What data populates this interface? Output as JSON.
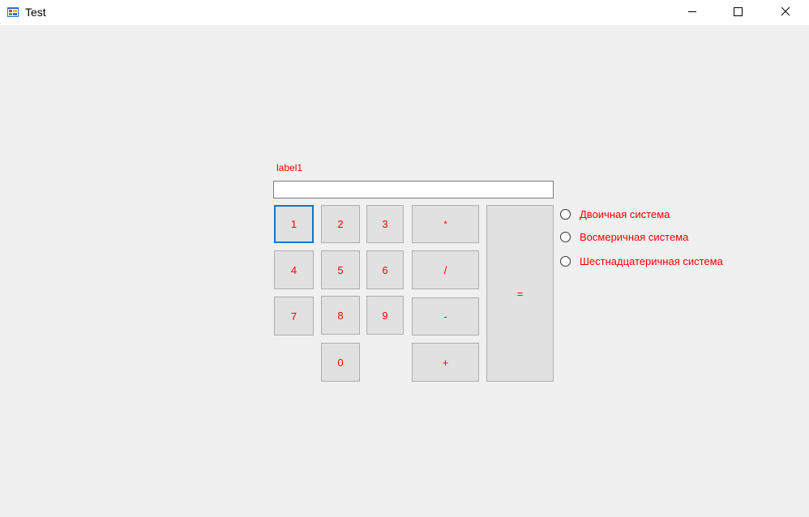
{
  "window": {
    "title": "Test",
    "minimize_icon": "minimize-icon",
    "maximize_icon": "maximize-icon",
    "close_icon": "close-icon",
    "app_icon": "winforms-app-icon"
  },
  "form": {
    "label": "label1",
    "input_value": "",
    "accent_color": "#ff0000",
    "focus_color": "#0078d7"
  },
  "buttons": {
    "b1": "1",
    "b2": "2",
    "b3": "3",
    "b4": "4",
    "b5": "5",
    "b6": "6",
    "b7": "7",
    "b8": "8",
    "b9": "9",
    "b0": "0",
    "multiply": "*",
    "divide": "/",
    "minus": "-",
    "plus": "+",
    "equals": "="
  },
  "radios": [
    {
      "label": "Двоичная система",
      "checked": false
    },
    {
      "label": "Восмеричная система",
      "checked": false
    },
    {
      "label": "Шестнадцатеричная система",
      "checked": false
    }
  ]
}
